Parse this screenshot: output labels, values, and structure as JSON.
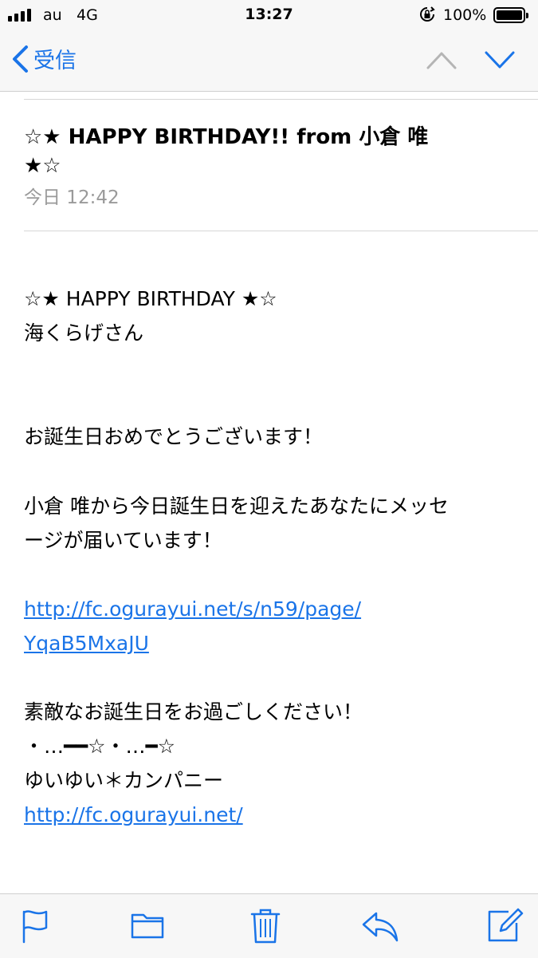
{
  "status_bar": {
    "carrier": "au",
    "network": "4G",
    "time": "13:27",
    "battery_percent": "100%"
  },
  "nav": {
    "back_label": "受信",
    "icons": [
      "chevron-left-icon",
      "chevron-up-icon",
      "chevron-down-icon"
    ]
  },
  "email": {
    "subject_line1": "☆★ HAPPY BIRTHDAY!! from 小倉 唯",
    "subject_line2": "★☆",
    "date": "今日 12:42",
    "body": {
      "greeting_title": "☆★ HAPPY BIRTHDAY ★☆",
      "recipient": "海くらげさん",
      "congrats": "お誕生日おめでとうございます！",
      "message_line1": "小倉 唯から今日誕生日を迎えたあなたにメッセ",
      "message_line2": "ージが届いています！",
      "link1_line1": "http://fc.ogurayui.net/s/n59/page/",
      "link1_line2": "YqaB5MxaJU",
      "closing": "素敵なお誕生日をお過ごしください！",
      "decoration": "・…━━☆・…━☆",
      "signature": "ゆいゆい＊カンパニー",
      "link2": "http://fc.ogurayui.net/"
    }
  },
  "toolbar": {
    "icons": [
      "flag-icon",
      "folder-icon",
      "trash-icon",
      "reply-icon",
      "compose-icon"
    ]
  },
  "colors": {
    "accent": "#1a74e8",
    "bar_background": "#f7f7f7",
    "secondary_text": "#9a9a9a"
  }
}
